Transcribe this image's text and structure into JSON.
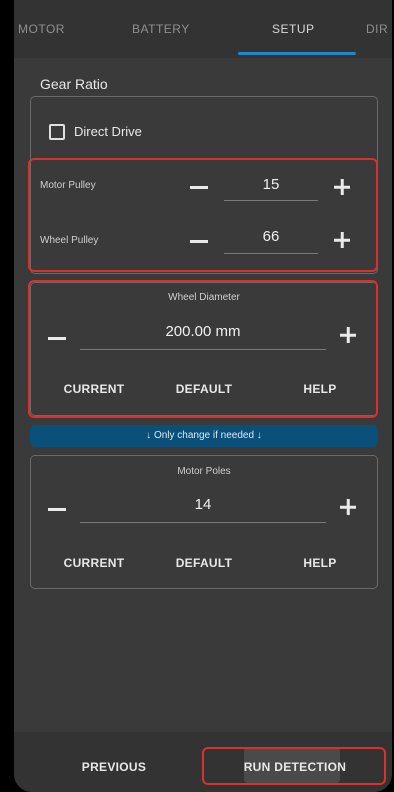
{
  "tabs": [
    "MOTOR",
    "BATTERY",
    "SETUP",
    "DIR"
  ],
  "section_title": "Gear Ratio",
  "direct_drive": {
    "label": "Direct Drive",
    "checked": false
  },
  "motor_pulley": {
    "label": "Motor Pulley",
    "value": "15"
  },
  "wheel_pulley": {
    "label": "Wheel Pulley",
    "value": "66"
  },
  "wheel_diameter": {
    "label": "Wheel Diameter",
    "value": "200.00 mm"
  },
  "actions": {
    "current": "CURRENT",
    "default": "DEFAULT",
    "help": "HELP"
  },
  "banner": "↓ Only change if needed ↓",
  "motor_poles": {
    "label": "Motor Poles",
    "value": "14"
  },
  "footer": {
    "previous": "PREVIOUS",
    "run": "RUN DETECTION"
  },
  "colors": {
    "accent": "#1e88c8",
    "highlight": "#d9312f",
    "banner": "#0b4f7b"
  }
}
